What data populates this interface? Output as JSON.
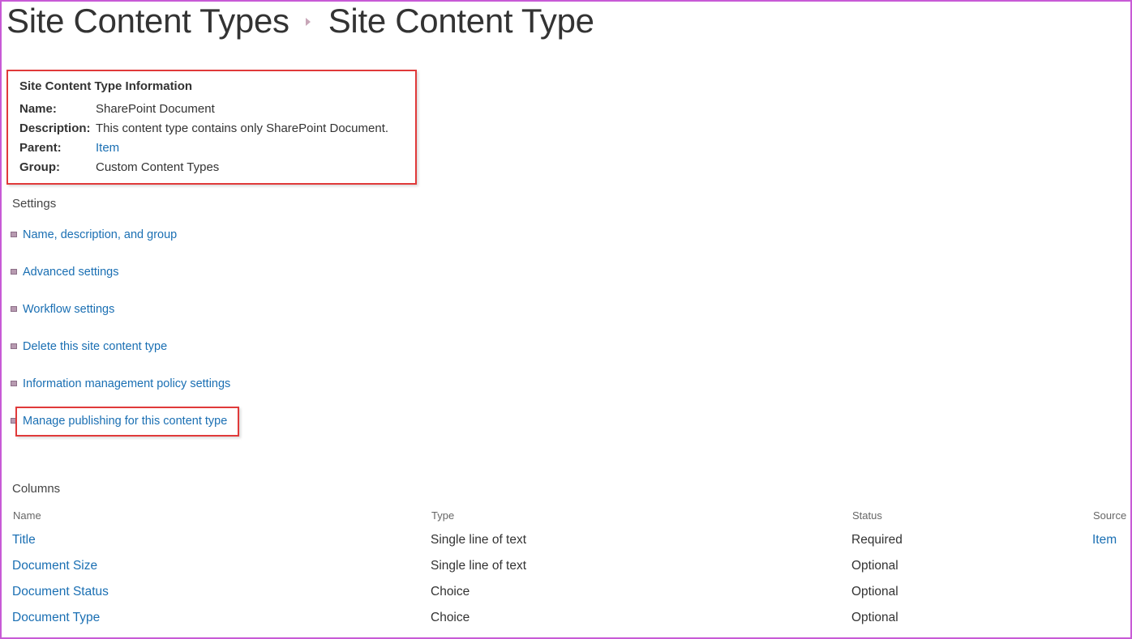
{
  "breadcrumb": {
    "parent": "Site Content Types",
    "current": "Site Content Type"
  },
  "info": {
    "title": "Site Content Type Information",
    "rows": [
      {
        "key": "Name:",
        "value": "SharePoint Document"
      },
      {
        "key": "Description:",
        "value": "This content type contains only SharePoint Document."
      },
      {
        "key": "Parent:",
        "value": "Item"
      },
      {
        "key": "Group:",
        "value": "Custom Content Types"
      }
    ]
  },
  "settings": {
    "label": "Settings",
    "items": [
      "Name, description, and group",
      "Advanced settings",
      "Workflow settings",
      "Delete this site content type",
      "Information management policy settings",
      "Manage publishing for this content type"
    ]
  },
  "columns": {
    "label": "Columns",
    "headers": {
      "name": "Name",
      "type": "Type",
      "status": "Status",
      "source": "Source"
    },
    "rows": [
      {
        "name": "Title",
        "type": "Single line of text",
        "status": "Required",
        "source": "Item"
      },
      {
        "name": "Document Size",
        "type": "Single line of text",
        "status": "Optional",
        "source": ""
      },
      {
        "name": "Document Status",
        "type": "Choice",
        "status": "Optional",
        "source": ""
      },
      {
        "name": "Document Type",
        "type": "Choice",
        "status": "Optional",
        "source": ""
      }
    ]
  },
  "colors": {
    "link": "#1a6fb3",
    "highlight": "#e03a3a",
    "frame": "#c85ad6"
  }
}
